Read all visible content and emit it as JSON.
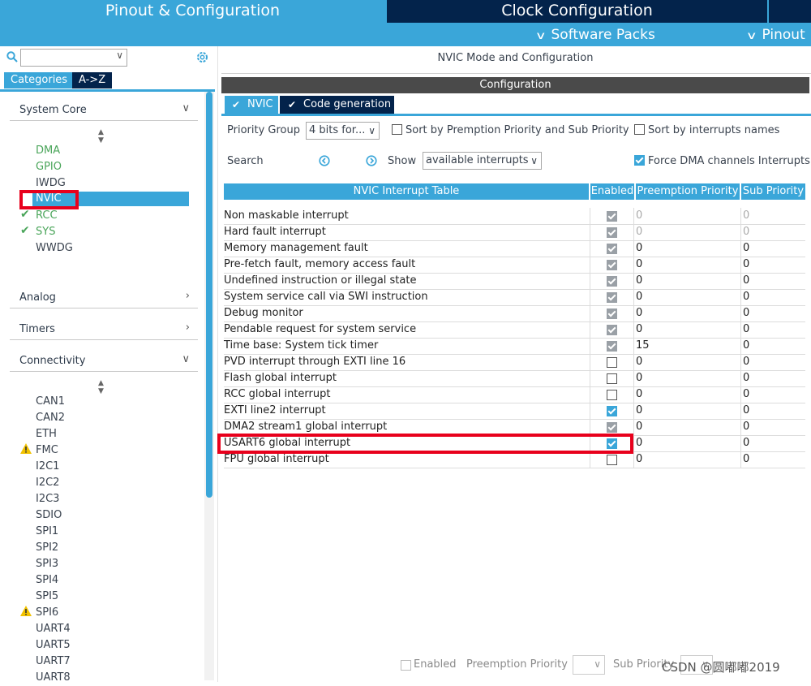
{
  "top_tabs": {
    "pinout": "Pinout & Configuration",
    "clock": "Clock Configuration"
  },
  "sub_menu": {
    "software_packs": "Software Packs",
    "pinout": "Pinout"
  },
  "left": {
    "categories_tab": "Categories",
    "az_tab": "A->Z",
    "sections": {
      "system_core": "System Core",
      "analog": "Analog",
      "timers": "Timers",
      "connectivity": "Connectivity"
    },
    "system_core_items": [
      "DMA",
      "GPIO",
      "IWDG",
      "NVIC",
      "RCC",
      "SYS",
      "WWDG"
    ],
    "connectivity_items": [
      "CAN1",
      "CAN2",
      "ETH",
      "FMC",
      "I2C1",
      "I2C2",
      "I2C3",
      "SDIO",
      "SPI1",
      "SPI2",
      "SPI3",
      "SPI4",
      "SPI5",
      "SPI6",
      "UART4",
      "UART5",
      "UART7",
      "UART8"
    ]
  },
  "right": {
    "mode_title": "NVIC Mode and Configuration",
    "configuration": "Configuration",
    "tab_nvic": "NVIC",
    "tab_codegen": "Code generation",
    "priority_group_label": "Priority Group",
    "priority_group_value": "4 bits for...",
    "sort_preemption": "Sort by Premption Priority and Sub Priority",
    "sort_names": "Sort by interrupts names",
    "search_label": "Search",
    "show_label": "Show",
    "show_value": "available interrupts",
    "force_dma": "Force DMA channels Interrupts",
    "table_headers": [
      "NVIC Interrupt Table",
      "Enabled",
      "Preemption Priority",
      "Sub Priority"
    ],
    "rows": [
      {
        "name": "Non maskable interrupt",
        "enabled": "locked",
        "pre": "0",
        "sub": "0",
        "dim": true
      },
      {
        "name": "Hard fault interrupt",
        "enabled": "locked",
        "pre": "0",
        "sub": "0",
        "dim": true
      },
      {
        "name": "Memory management fault",
        "enabled": "locked",
        "pre": "0",
        "sub": "0",
        "dim": false
      },
      {
        "name": "Pre-fetch fault, memory access fault",
        "enabled": "locked",
        "pre": "0",
        "sub": "0",
        "dim": false
      },
      {
        "name": "Undefined instruction or illegal state",
        "enabled": "locked",
        "pre": "0",
        "sub": "0",
        "dim": false
      },
      {
        "name": "System service call via SWI instruction",
        "enabled": "locked",
        "pre": "0",
        "sub": "0",
        "dim": false
      },
      {
        "name": "Debug monitor",
        "enabled": "locked",
        "pre": "0",
        "sub": "0",
        "dim": false
      },
      {
        "name": "Pendable request for system service",
        "enabled": "locked",
        "pre": "0",
        "sub": "0",
        "dim": false
      },
      {
        "name": "Time base: System tick timer",
        "enabled": "locked",
        "pre": "15",
        "sub": "0",
        "dim": false
      },
      {
        "name": "PVD interrupt through EXTI line 16",
        "enabled": "off",
        "pre": "0",
        "sub": "0",
        "dim": false
      },
      {
        "name": "Flash global interrupt",
        "enabled": "off",
        "pre": "0",
        "sub": "0",
        "dim": false
      },
      {
        "name": "RCC global interrupt",
        "enabled": "off",
        "pre": "0",
        "sub": "0",
        "dim": false
      },
      {
        "name": "EXTI line2 interrupt",
        "enabled": "on",
        "pre": "0",
        "sub": "0",
        "dim": false
      },
      {
        "name": "DMA2 stream1 global interrupt",
        "enabled": "locked",
        "pre": "0",
        "sub": "0",
        "dim": false
      },
      {
        "name": "USART6 global interrupt",
        "enabled": "on",
        "pre": "0",
        "sub": "0",
        "dim": false
      },
      {
        "name": "FPU global interrupt",
        "enabled": "off",
        "pre": "0",
        "sub": "0",
        "dim": false
      }
    ],
    "bottom_enabled": "Enabled",
    "bottom_preemption": "Preemption Priority",
    "bottom_sub": "Sub Priority",
    "watermark": "CSDN @圆嘟嘟2019"
  },
  "colors": {
    "accent": "#3aa6d9",
    "dark_tab": "#03234b",
    "highlight_red": "#e8001c",
    "ok_green": "#4aa55a",
    "warn_yellow": "#f2c200"
  }
}
